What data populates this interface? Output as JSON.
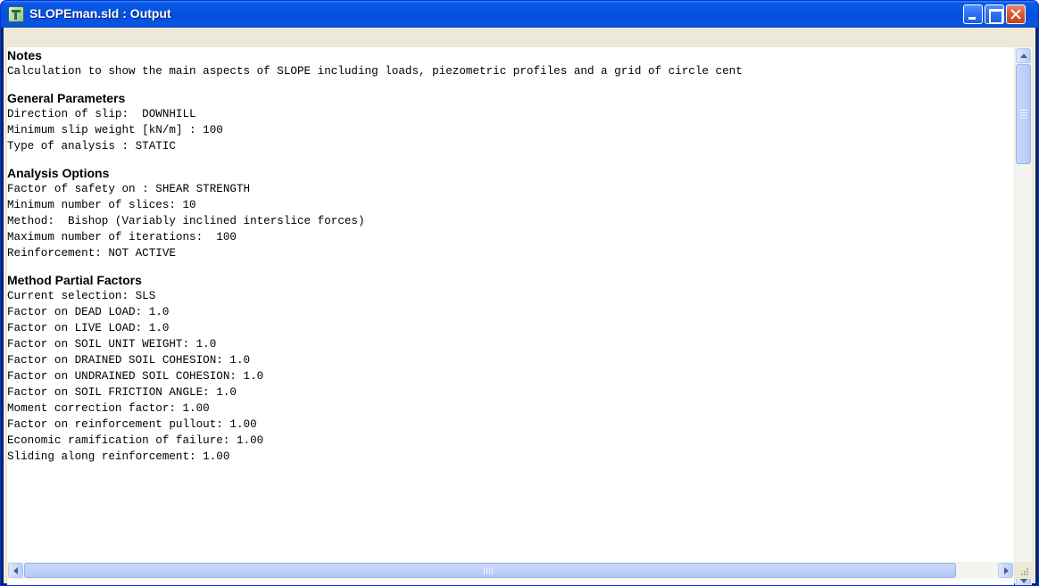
{
  "window": {
    "title": "SLOPEman.sld : Output"
  },
  "sections": [
    {
      "heading": "Notes",
      "lines": [
        "Calculation to show the main aspects of SLOPE including loads, piezometric profiles and a grid of circle cent"
      ]
    },
    {
      "heading": "General Parameters",
      "lines": [
        "Direction of slip:  DOWNHILL",
        "Minimum slip weight [kN/m] : 100",
        "Type of analysis : STATIC"
      ]
    },
    {
      "heading": "Analysis Options",
      "lines": [
        "Factor of safety on : SHEAR STRENGTH",
        "Minimum number of slices: 10",
        "Method:  Bishop (Variably inclined interslice forces)",
        "Maximum number of iterations:  100",
        "Reinforcement: NOT ACTIVE"
      ]
    },
    {
      "heading": "Method Partial Factors",
      "lines": [
        "Current selection: SLS",
        "Factor on DEAD LOAD: 1.0",
        "Factor on LIVE LOAD: 1.0",
        "Factor on SOIL UNIT WEIGHT: 1.0",
        "Factor on DRAINED SOIL COHESION: 1.0",
        "Factor on UNDRAINED SOIL COHESION: 1.0",
        "Factor on SOIL FRICTION ANGLE: 1.0",
        "Moment correction factor: 1.00",
        "Factor on reinforcement pullout: 1.00",
        "Economic ramification of failure: 1.00",
        "Sliding along reinforcement: 1.00"
      ]
    }
  ],
  "icons": {
    "app": "slope-app-icon",
    "minimize": "minimize-icon",
    "maximize": "maximize-icon",
    "close": "close-icon"
  },
  "colors": {
    "titlebar": "#0453e1",
    "close_button": "#d9562e",
    "frame": "#ece9d8",
    "scrollbar_thumb": "#b4c8f6"
  }
}
